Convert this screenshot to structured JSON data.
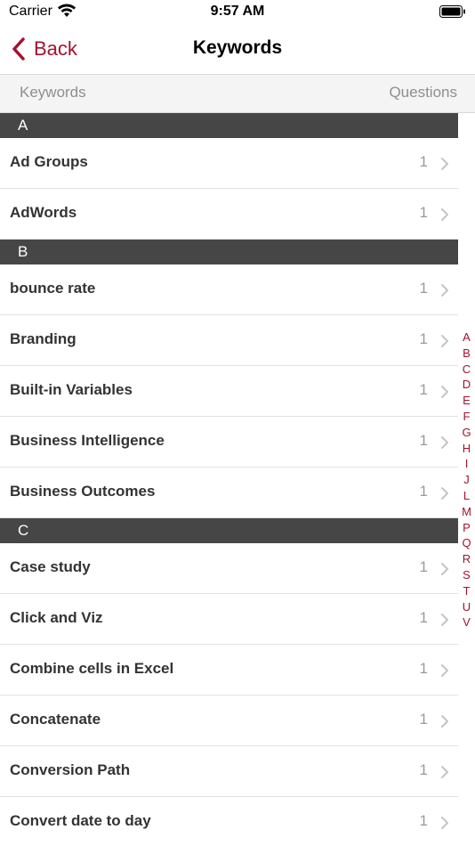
{
  "status": {
    "carrier": "Carrier",
    "time": "9:57 AM"
  },
  "nav": {
    "back_label": "Back",
    "title": "Keywords"
  },
  "columns": {
    "left": "Keywords",
    "right": "Questions"
  },
  "sections": [
    {
      "letter": "A",
      "rows": [
        {
          "label": "Ad Groups",
          "count": "1"
        },
        {
          "label": "AdWords",
          "count": "1"
        }
      ]
    },
    {
      "letter": "B",
      "rows": [
        {
          "label": "bounce rate",
          "count": "1"
        },
        {
          "label": "Branding",
          "count": "1"
        },
        {
          "label": "Built-in Variables",
          "count": "1"
        },
        {
          "label": "Business Intelligence",
          "count": "1"
        },
        {
          "label": "Business Outcomes",
          "count": "1"
        }
      ]
    },
    {
      "letter": "C",
      "rows": [
        {
          "label": "Case study",
          "count": "1"
        },
        {
          "label": "Click and Viz",
          "count": "1"
        },
        {
          "label": "Combine cells in Excel",
          "count": "1"
        },
        {
          "label": "Concatenate",
          "count": "1"
        },
        {
          "label": "Conversion Path",
          "count": "1"
        },
        {
          "label": "Convert date to day",
          "count": "1"
        }
      ]
    }
  ],
  "index_letters": [
    "A",
    "B",
    "C",
    "D",
    "E",
    "F",
    "G",
    "H",
    "I",
    "J",
    "L",
    "M",
    "P",
    "Q",
    "R",
    "S",
    "T",
    "U",
    "V"
  ],
  "colors": {
    "accent": "#a3122f",
    "section_bg": "#464646"
  }
}
